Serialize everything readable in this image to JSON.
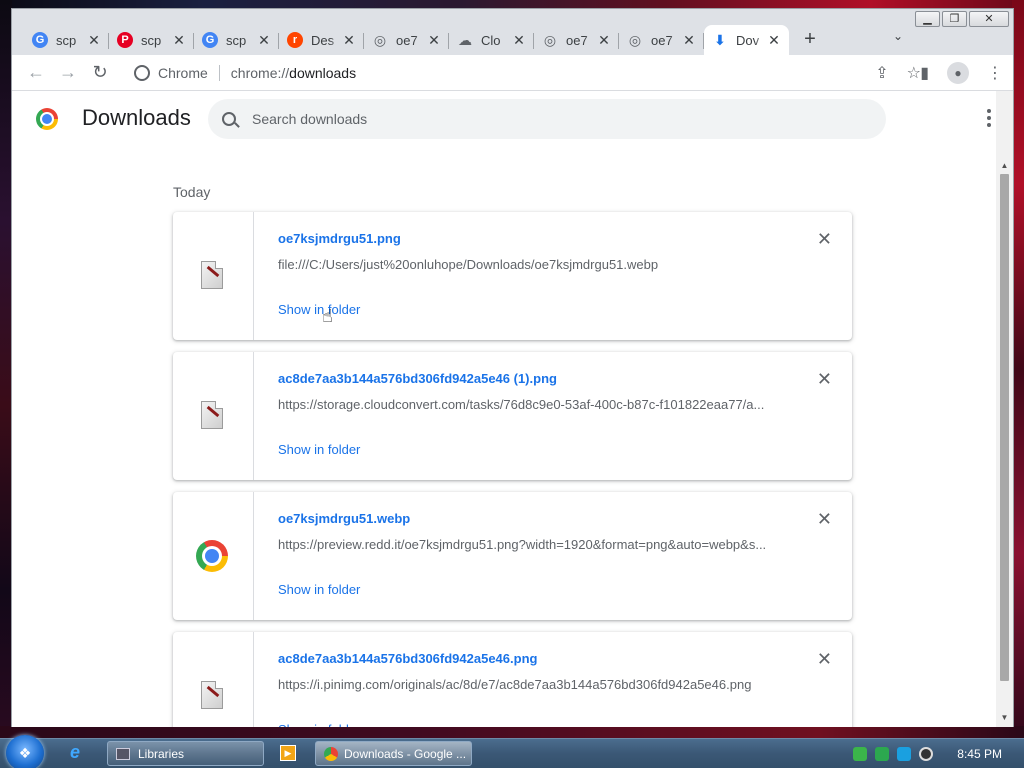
{
  "tabs": [
    {
      "title": "scp",
      "favicon": "google-icon",
      "color": "#4285f4",
      "glyph": "G"
    },
    {
      "title": "scp",
      "favicon": "pinterest-icon",
      "color": "#e60023",
      "glyph": "P"
    },
    {
      "title": "scp",
      "favicon": "google-icon",
      "color": "#4285f4",
      "glyph": "G"
    },
    {
      "title": "Des",
      "favicon": "reddit-icon",
      "color": "#ff4500",
      "glyph": "r"
    },
    {
      "title": "oe7",
      "favicon": "globe-icon",
      "color": "#5f6368",
      "glyph": "◎"
    },
    {
      "title": "Clo",
      "favicon": "cloud-icon",
      "color": "#5f6368",
      "glyph": "☁"
    },
    {
      "title": "oe7",
      "favicon": "globe-icon",
      "color": "#5f6368",
      "glyph": "◎"
    },
    {
      "title": "oe7",
      "favicon": "globe-icon",
      "color": "#5f6368",
      "glyph": "◎"
    },
    {
      "title": "Dov",
      "favicon": "download-icon",
      "color": "#1a73e8",
      "glyph": "⬇",
      "active": true
    }
  ],
  "toolbar": {
    "chip_label": "Chrome",
    "url_scheme": "chrome://",
    "url_host": "downloads"
  },
  "page": {
    "title": "Downloads",
    "search_placeholder": "Search downloads",
    "date_label": "Today"
  },
  "downloads": [
    {
      "name": "oe7ksjmdrgu51.png",
      "url": "file:///C:/Users/just%20onluhope/Downloads/oe7ksjmdrgu51.webp",
      "action": "Show in folder",
      "icon": "file-icon"
    },
    {
      "name": "ac8de7aa3b144a576bd306fd942a5e46 (1).png",
      "url": "https://storage.cloudconvert.com/tasks/76d8c9e0-53af-400c-b87c-f101822eaa77/a...",
      "action": "Show in folder",
      "icon": "file-icon"
    },
    {
      "name": "oe7ksjmdrgu51.webp",
      "url": "https://preview.redd.it/oe7ksjmdrgu51.png?width=1920&format=png&auto=webp&s...",
      "action": "Show in folder",
      "icon": "chrome-icon"
    },
    {
      "name": "ac8de7aa3b144a576bd306fd942a5e46.png",
      "url": "https://i.pinimg.com/originals/ac/8d/e7/ac8de7aa3b144a576bd306fd942a5e46.png",
      "action": "Show in folder",
      "icon": "file-icon"
    }
  ],
  "taskbar": {
    "libraries_label": "Libraries",
    "chrome_label": "Downloads - Google ...",
    "clock": "8:45 PM"
  },
  "colors": {
    "link": "#1a73e8",
    "secondary_text": "#5f6368",
    "tabstrip_bg": "#dee1e6"
  }
}
